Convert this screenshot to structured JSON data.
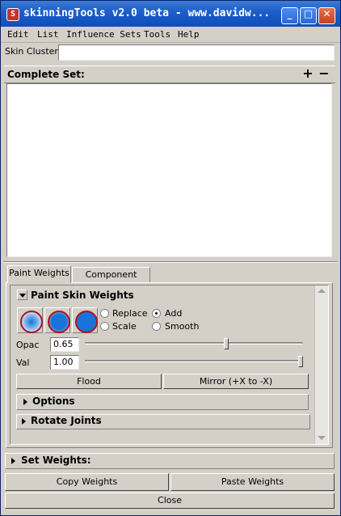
{
  "window": {
    "title": "skinningTools v2.0 beta - www.davidw...",
    "icon": "maya-app-icon"
  },
  "titlebar_buttons": {
    "minimize": "_",
    "maximize": "□",
    "close": "✕"
  },
  "menu": [
    "Edit",
    "List",
    "Influence Sets",
    "Tools",
    "Help"
  ],
  "skin_cluster": {
    "label": "Skin Cluster:",
    "value": ""
  },
  "complete_set": {
    "label": "Complete Set:",
    "add": "+",
    "remove": "−"
  },
  "tabs": [
    {
      "label": "Paint Weights",
      "active": true
    },
    {
      "label": "Component Editor",
      "active": false
    }
  ],
  "paint": {
    "header": "Paint Skin Weights",
    "brushes": [
      "soft-brush-icon",
      "medium-brush-icon",
      "hard-brush-icon"
    ],
    "operations": [
      {
        "label": "Replace",
        "selected": false
      },
      {
        "label": "Add",
        "selected": true
      },
      {
        "label": "Scale",
        "selected": false
      },
      {
        "label": "Smooth",
        "selected": false
      }
    ],
    "opacity": {
      "label": "Opac",
      "value": "0.65",
      "level": 0.65
    },
    "value": {
      "label": "Val",
      "value": "1.00",
      "level": 1.0
    },
    "flood_button": "Flood",
    "mirror_button": "Mirror (+X to -X)",
    "options_label": "Options",
    "rotate_label": "Rotate Joints"
  },
  "set_weights": {
    "label": "Set Weights:"
  },
  "copy_button": "Copy Weights",
  "paste_button": "Paste Weights",
  "close_button": "Close",
  "colors": {
    "title_bar": "#1e5fc9",
    "window_bg": "#d4d0c8",
    "brush_blue": "#1a73d9",
    "brush_ring": "#b0101f"
  }
}
